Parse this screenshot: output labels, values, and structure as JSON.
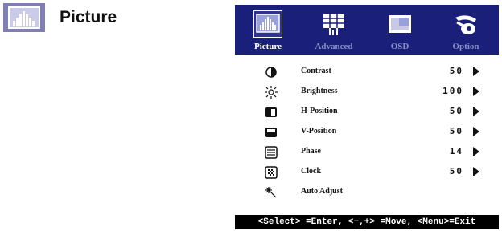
{
  "header": {
    "title": "Picture",
    "icon": "picture-icon"
  },
  "osd": {
    "tabs": [
      {
        "label": "Picture",
        "icon": "picture-icon",
        "active": true
      },
      {
        "label": "Advanced",
        "icon": "advanced-grid-icon",
        "active": false
      },
      {
        "label": "OSD",
        "icon": "osd-window-icon",
        "active": false
      },
      {
        "label": "Option",
        "icon": "hand-option-icon",
        "active": false
      }
    ],
    "items": [
      {
        "label": "Contrast",
        "value": "50",
        "icon": "contrast-icon"
      },
      {
        "label": "Brightness",
        "value": "100",
        "icon": "brightness-icon"
      },
      {
        "label": "H-Position",
        "value": "50",
        "icon": "h-position-icon"
      },
      {
        "label": "V-Position",
        "value": "50",
        "icon": "v-position-icon"
      },
      {
        "label": "Phase",
        "value": "14",
        "icon": "phase-icon"
      },
      {
        "label": "Clock",
        "value": "50",
        "icon": "clock-icon"
      },
      {
        "label": "Auto Adjust",
        "value": "",
        "icon": "auto-adjust-icon"
      }
    ],
    "footer": "<Select> =Enter, <−,+> =Move, <Menu>=Exit"
  },
  "colors": {
    "tab_bar": "#1a1f7a",
    "inactive_tab_text": "#8a8fc8",
    "header_icon_bg": "#7f7fb5"
  }
}
